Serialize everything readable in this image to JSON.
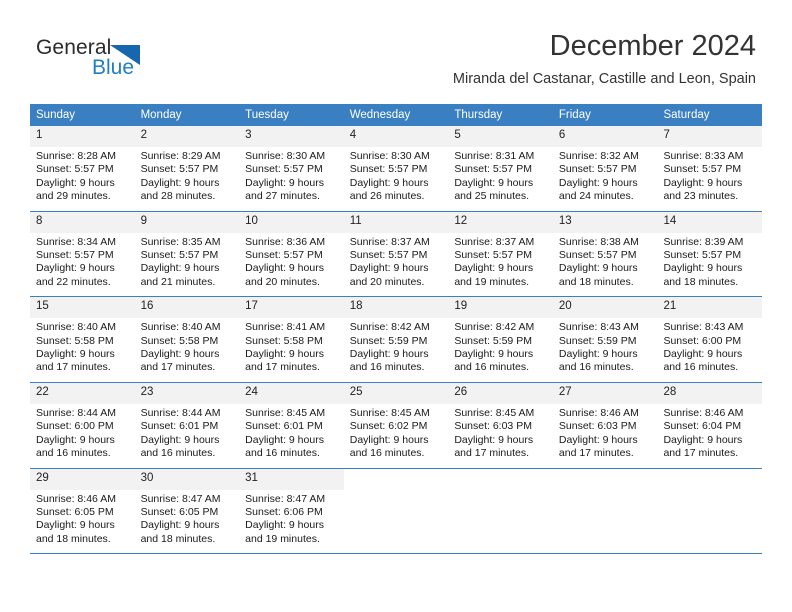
{
  "brand": {
    "name_part1": "General",
    "name_part2": "Blue",
    "logo_icon": "triangle-icon",
    "accent_color": "#1f7fc4"
  },
  "header": {
    "month_title": "December 2024",
    "location": "Miranda del Castanar, Castille and Leon, Spain"
  },
  "calendar": {
    "header_bg_color": "#3a7fc1",
    "day_band_color": "#f2f2f2",
    "weekdays": [
      "Sunday",
      "Monday",
      "Tuesday",
      "Wednesday",
      "Thursday",
      "Friday",
      "Saturday"
    ],
    "weeks": [
      [
        {
          "day": "1",
          "sunrise": "Sunrise: 8:28 AM",
          "sunset": "Sunset: 5:57 PM",
          "daylight_line1": "Daylight: 9 hours",
          "daylight_line2": "and 29 minutes."
        },
        {
          "day": "2",
          "sunrise": "Sunrise: 8:29 AM",
          "sunset": "Sunset: 5:57 PM",
          "daylight_line1": "Daylight: 9 hours",
          "daylight_line2": "and 28 minutes."
        },
        {
          "day": "3",
          "sunrise": "Sunrise: 8:30 AM",
          "sunset": "Sunset: 5:57 PM",
          "daylight_line1": "Daylight: 9 hours",
          "daylight_line2": "and 27 minutes."
        },
        {
          "day": "4",
          "sunrise": "Sunrise: 8:30 AM",
          "sunset": "Sunset: 5:57 PM",
          "daylight_line1": "Daylight: 9 hours",
          "daylight_line2": "and 26 minutes."
        },
        {
          "day": "5",
          "sunrise": "Sunrise: 8:31 AM",
          "sunset": "Sunset: 5:57 PM",
          "daylight_line1": "Daylight: 9 hours",
          "daylight_line2": "and 25 minutes."
        },
        {
          "day": "6",
          "sunrise": "Sunrise: 8:32 AM",
          "sunset": "Sunset: 5:57 PM",
          "daylight_line1": "Daylight: 9 hours",
          "daylight_line2": "and 24 minutes."
        },
        {
          "day": "7",
          "sunrise": "Sunrise: 8:33 AM",
          "sunset": "Sunset: 5:57 PM",
          "daylight_line1": "Daylight: 9 hours",
          "daylight_line2": "and 23 minutes."
        }
      ],
      [
        {
          "day": "8",
          "sunrise": "Sunrise: 8:34 AM",
          "sunset": "Sunset: 5:57 PM",
          "daylight_line1": "Daylight: 9 hours",
          "daylight_line2": "and 22 minutes."
        },
        {
          "day": "9",
          "sunrise": "Sunrise: 8:35 AM",
          "sunset": "Sunset: 5:57 PM",
          "daylight_line1": "Daylight: 9 hours",
          "daylight_line2": "and 21 minutes."
        },
        {
          "day": "10",
          "sunrise": "Sunrise: 8:36 AM",
          "sunset": "Sunset: 5:57 PM",
          "daylight_line1": "Daylight: 9 hours",
          "daylight_line2": "and 20 minutes."
        },
        {
          "day": "11",
          "sunrise": "Sunrise: 8:37 AM",
          "sunset": "Sunset: 5:57 PM",
          "daylight_line1": "Daylight: 9 hours",
          "daylight_line2": "and 20 minutes."
        },
        {
          "day": "12",
          "sunrise": "Sunrise: 8:37 AM",
          "sunset": "Sunset: 5:57 PM",
          "daylight_line1": "Daylight: 9 hours",
          "daylight_line2": "and 19 minutes."
        },
        {
          "day": "13",
          "sunrise": "Sunrise: 8:38 AM",
          "sunset": "Sunset: 5:57 PM",
          "daylight_line1": "Daylight: 9 hours",
          "daylight_line2": "and 18 minutes."
        },
        {
          "day": "14",
          "sunrise": "Sunrise: 8:39 AM",
          "sunset": "Sunset: 5:57 PM",
          "daylight_line1": "Daylight: 9 hours",
          "daylight_line2": "and 18 minutes."
        }
      ],
      [
        {
          "day": "15",
          "sunrise": "Sunrise: 8:40 AM",
          "sunset": "Sunset: 5:58 PM",
          "daylight_line1": "Daylight: 9 hours",
          "daylight_line2": "and 17 minutes."
        },
        {
          "day": "16",
          "sunrise": "Sunrise: 8:40 AM",
          "sunset": "Sunset: 5:58 PM",
          "daylight_line1": "Daylight: 9 hours",
          "daylight_line2": "and 17 minutes."
        },
        {
          "day": "17",
          "sunrise": "Sunrise: 8:41 AM",
          "sunset": "Sunset: 5:58 PM",
          "daylight_line1": "Daylight: 9 hours",
          "daylight_line2": "and 17 minutes."
        },
        {
          "day": "18",
          "sunrise": "Sunrise: 8:42 AM",
          "sunset": "Sunset: 5:59 PM",
          "daylight_line1": "Daylight: 9 hours",
          "daylight_line2": "and 16 minutes."
        },
        {
          "day": "19",
          "sunrise": "Sunrise: 8:42 AM",
          "sunset": "Sunset: 5:59 PM",
          "daylight_line1": "Daylight: 9 hours",
          "daylight_line2": "and 16 minutes."
        },
        {
          "day": "20",
          "sunrise": "Sunrise: 8:43 AM",
          "sunset": "Sunset: 5:59 PM",
          "daylight_line1": "Daylight: 9 hours",
          "daylight_line2": "and 16 minutes."
        },
        {
          "day": "21",
          "sunrise": "Sunrise: 8:43 AM",
          "sunset": "Sunset: 6:00 PM",
          "daylight_line1": "Daylight: 9 hours",
          "daylight_line2": "and 16 minutes."
        }
      ],
      [
        {
          "day": "22",
          "sunrise": "Sunrise: 8:44 AM",
          "sunset": "Sunset: 6:00 PM",
          "daylight_line1": "Daylight: 9 hours",
          "daylight_line2": "and 16 minutes."
        },
        {
          "day": "23",
          "sunrise": "Sunrise: 8:44 AM",
          "sunset": "Sunset: 6:01 PM",
          "daylight_line1": "Daylight: 9 hours",
          "daylight_line2": "and 16 minutes."
        },
        {
          "day": "24",
          "sunrise": "Sunrise: 8:45 AM",
          "sunset": "Sunset: 6:01 PM",
          "daylight_line1": "Daylight: 9 hours",
          "daylight_line2": "and 16 minutes."
        },
        {
          "day": "25",
          "sunrise": "Sunrise: 8:45 AM",
          "sunset": "Sunset: 6:02 PM",
          "daylight_line1": "Daylight: 9 hours",
          "daylight_line2": "and 16 minutes."
        },
        {
          "day": "26",
          "sunrise": "Sunrise: 8:45 AM",
          "sunset": "Sunset: 6:03 PM",
          "daylight_line1": "Daylight: 9 hours",
          "daylight_line2": "and 17 minutes."
        },
        {
          "day": "27",
          "sunrise": "Sunrise: 8:46 AM",
          "sunset": "Sunset: 6:03 PM",
          "daylight_line1": "Daylight: 9 hours",
          "daylight_line2": "and 17 minutes."
        },
        {
          "day": "28",
          "sunrise": "Sunrise: 8:46 AM",
          "sunset": "Sunset: 6:04 PM",
          "daylight_line1": "Daylight: 9 hours",
          "daylight_line2": "and 17 minutes."
        }
      ],
      [
        {
          "day": "29",
          "sunrise": "Sunrise: 8:46 AM",
          "sunset": "Sunset: 6:05 PM",
          "daylight_line1": "Daylight: 9 hours",
          "daylight_line2": "and 18 minutes."
        },
        {
          "day": "30",
          "sunrise": "Sunrise: 8:47 AM",
          "sunset": "Sunset: 6:05 PM",
          "daylight_line1": "Daylight: 9 hours",
          "daylight_line2": "and 18 minutes."
        },
        {
          "day": "31",
          "sunrise": "Sunrise: 8:47 AM",
          "sunset": "Sunset: 6:06 PM",
          "daylight_line1": "Daylight: 9 hours",
          "daylight_line2": "and 19 minutes."
        },
        {
          "day": "",
          "sunrise": "",
          "sunset": "",
          "daylight_line1": "",
          "daylight_line2": ""
        },
        {
          "day": "",
          "sunrise": "",
          "sunset": "",
          "daylight_line1": "",
          "daylight_line2": ""
        },
        {
          "day": "",
          "sunrise": "",
          "sunset": "",
          "daylight_line1": "",
          "daylight_line2": ""
        },
        {
          "day": "",
          "sunrise": "",
          "sunset": "",
          "daylight_line1": "",
          "daylight_line2": ""
        }
      ]
    ]
  }
}
